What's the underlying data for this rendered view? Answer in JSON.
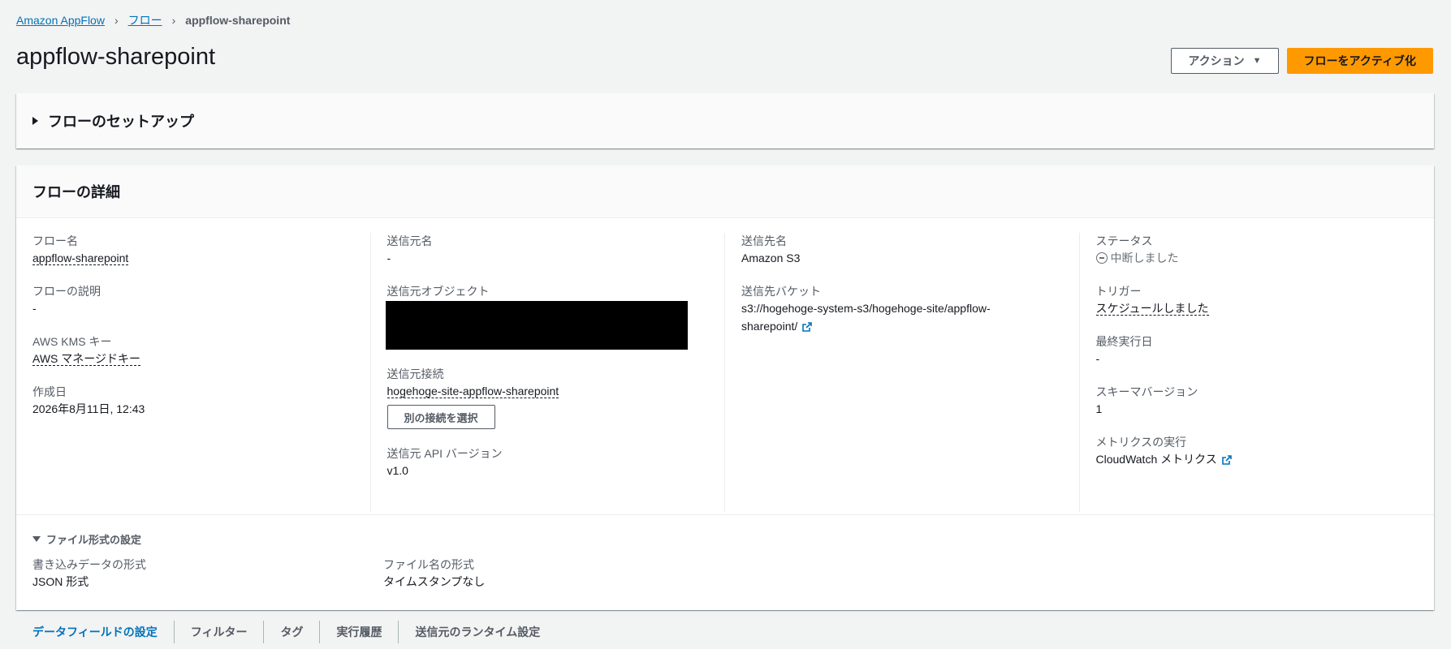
{
  "breadcrumb": {
    "root": "Amazon AppFlow",
    "flows": "フロー",
    "current": "appflow-sharepoint"
  },
  "page": {
    "title": "appflow-sharepoint",
    "actions_label": "アクション",
    "activate_label": "フローをアクティブ化"
  },
  "setup": {
    "title": "フローのセットアップ"
  },
  "details": {
    "title": "フローの詳細",
    "col1": {
      "flow_name_label": "フロー名",
      "flow_name": "appflow-sharepoint",
      "description_label": "フローの説明",
      "description": "-",
      "kms_label": "AWS KMS キー",
      "kms": "AWS マネージドキー",
      "created_label": "作成日",
      "created": "2026年8月11日, 12:43"
    },
    "col2": {
      "source_name_label": "送信元名",
      "source_name": "-",
      "source_object_label": "送信元オブジェクト",
      "source_connection_label": "送信元接続",
      "source_connection": "hogehoge-site-appflow-sharepoint",
      "choose_connection": "別の接続を選択",
      "api_version_label": "送信元 API バージョン",
      "api_version": "v1.0"
    },
    "col3": {
      "dest_name_label": "送信先名",
      "dest_name": "Amazon S3",
      "bucket_label": "送信先バケット",
      "bucket_line1": "s3://hogehoge-system-s3/hogehoge-site/appflow-",
      "bucket_line2": "sharepoint/"
    },
    "col4": {
      "status_label": "ステータス",
      "status": "中断しました",
      "trigger_label": "トリガー",
      "trigger": "スケジュールしました",
      "last_run_label": "最終実行日",
      "last_run": "-",
      "schema_label": "スキーマバージョン",
      "schema": "1",
      "metrics_label": "メトリクスの実行",
      "metrics": "CloudWatch メトリクス"
    },
    "file_format": {
      "title": "ファイル形式の設定",
      "write_label": "書き込みデータの形式",
      "write_value": "JSON 形式",
      "filename_label": "ファイル名の形式",
      "filename_value": "タイムスタンプなし"
    }
  },
  "tabs": [
    "データフィールドの設定",
    "フィルター",
    "タグ",
    "実行履歴",
    "送信元のランタイム設定"
  ]
}
